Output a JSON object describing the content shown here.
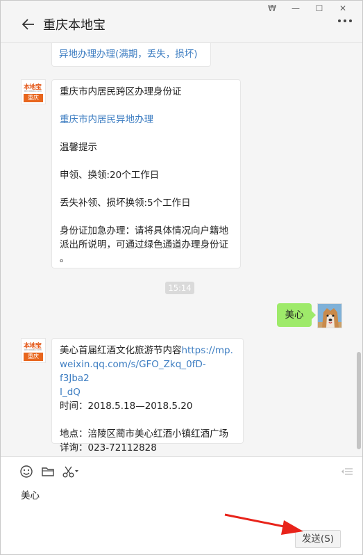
{
  "window": {
    "controls": [
      "₩",
      "—",
      "☐",
      "✕"
    ]
  },
  "header": {
    "title": "重庆本地宝"
  },
  "avatar": {
    "brand_top": "本地宝",
    "brand_mid": "Bendibao.com",
    "brand_city": "重庆"
  },
  "messages": {
    "m1": "异地办理办理(满期，丢失，损坏)",
    "m2": {
      "title": "重庆市内居民跨区办理身份证",
      "link": "重庆市内居民异地办理",
      "tip": "温馨提示",
      "line1": "申领、换领:20个工作日",
      "line2": "丢失补领、损坏换领:5个工作日",
      "urgent_a": "身份证加急办理：请将具体情况向户籍地",
      "urgent_b": "派出所说明，可通过绿色通道办理身份证",
      "urgent_c": "。"
    },
    "time": "15:14",
    "user_msg": "美心",
    "m3": {
      "prefix": "美心首届红酒文化旅游节内容",
      "url_a": "https://mp.",
      "url_b": "weixin.qq.com/s/GFO_Zkq_0fD-f3Jba2",
      "url_c": "I_dQ",
      "time": "时间：2018.5.18—2018.5.20",
      "place": "地点：涪陵区蔺市美心红酒小镇红酒广场",
      "contact": "详询：023-72112828"
    }
  },
  "input": {
    "typed": "美心",
    "send_label": "发送(S)"
  },
  "colors": {
    "link": "#3e7ec2",
    "green_bubble": "#9eea6a",
    "arrow": "#e8231a",
    "brand_orange": "#e8661e"
  }
}
